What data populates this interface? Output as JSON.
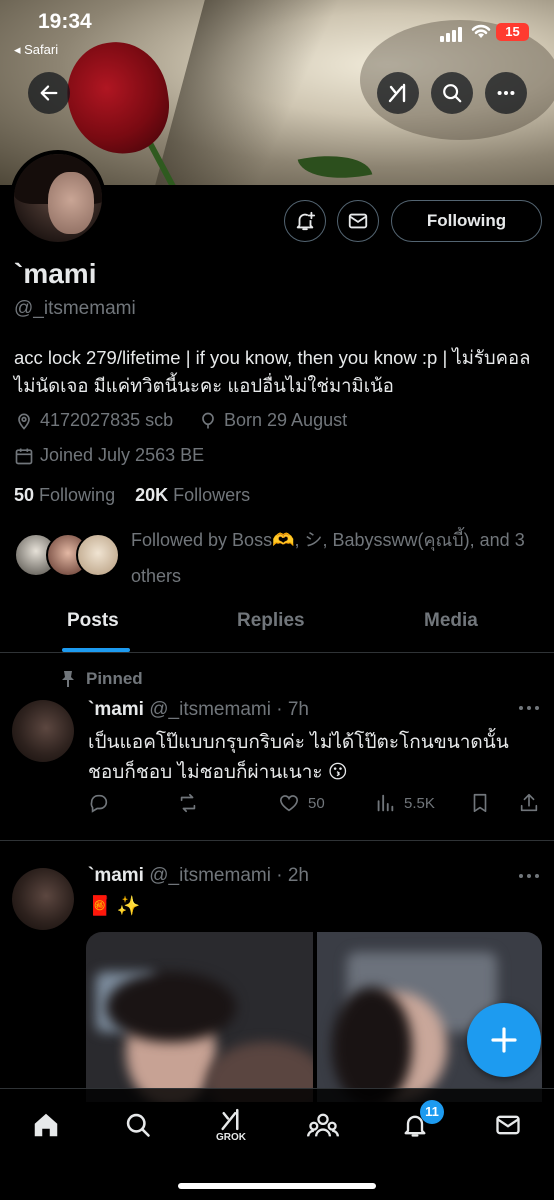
{
  "status_bar": {
    "time": "19:34",
    "back_app": "◂ Safari",
    "battery": "15"
  },
  "profile": {
    "name": "`mami",
    "handle": "@_itsmemami",
    "bio": "acc lock 279/lifetime | if you know, then you know :p | ไม่รับคอล ไม่นัดเจอ มีแค่ทวิตนี้นะคะ แอปอื่นไม่ใช่มามิเน้อ",
    "location": "4172027835 scb",
    "birthday": "Born 29 August",
    "joined": "Joined July 2563 BE",
    "following_count": "50",
    "following_label": "Following",
    "followers_count": "20K",
    "followers_label": "Followers",
    "followed_by": "Followed by Boss🫶, シ, Babyssww(คุณบี้), and 3 others",
    "follow_button": "Following"
  },
  "tabs": [
    {
      "label": "Posts",
      "active": true
    },
    {
      "label": "Replies",
      "active": false
    },
    {
      "label": "Media",
      "active": false
    }
  ],
  "posts": [
    {
      "pinned_label": "Pinned",
      "name": "`mami",
      "handle_time": "@_itsmemami · 7h",
      "text": "เป็นแอคโป๊แบบกรุบกริบค่ะ ไม่ได้โป๊ตะโกนขนาดนั้น ชอบก็ชอบ ไม่ชอบก็ผ่านเนาะ 😗",
      "likes": "50",
      "views": "5.5K"
    },
    {
      "name": "`mami",
      "handle_time": "@_itsmemami · 2h",
      "text": "🧧 ✨"
    }
  ],
  "bottom_nav": {
    "grok_label": "GROK",
    "notifications_badge": "11"
  },
  "colors": {
    "accent": "#1d9bf0",
    "muted": "#71767b",
    "battery": "#ff3b30"
  }
}
